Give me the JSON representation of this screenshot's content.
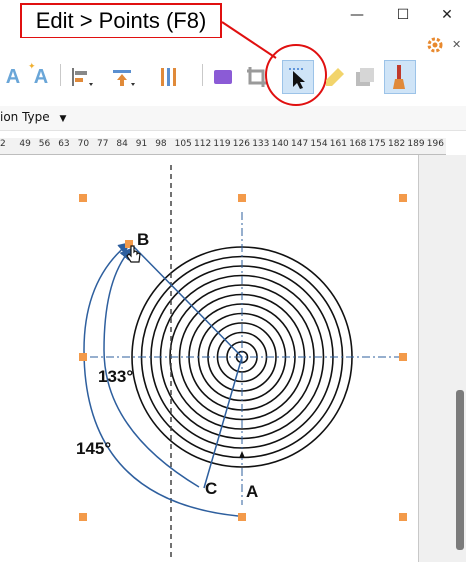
{
  "callout": {
    "text": "Edit > Points (F8)"
  },
  "window": {
    "minimize": "—",
    "maximize": "☐",
    "close": "✕"
  },
  "toolbar": {
    "tools": [
      {
        "name": "text-style-a-icon"
      },
      {
        "name": "text-effect-a-icon"
      },
      {
        "name": "align-left-icon"
      },
      {
        "name": "move-up-icon"
      },
      {
        "name": "distribute-icon"
      },
      {
        "name": "fill-color-icon"
      },
      {
        "name": "crop-icon"
      },
      {
        "name": "edit-points-icon"
      },
      {
        "name": "highlighter-icon"
      },
      {
        "name": "shadow-icon"
      },
      {
        "name": "brush-icon"
      }
    ],
    "active_tool": "edit-points-icon"
  },
  "properties": {
    "position_type": "ion Type"
  },
  "ruler": {
    "labels": [
      "2",
      "49",
      "56",
      "63",
      "70",
      "77",
      "84",
      "91",
      "98",
      "105",
      "112",
      "119",
      "126",
      "133",
      "140",
      "147",
      "154",
      "161",
      "168",
      "175",
      "182",
      "189",
      "196"
    ]
  },
  "diagram": {
    "labels": {
      "b": "B",
      "a": "A",
      "c": "C",
      "angle_small": "133°",
      "angle_large": "145°"
    },
    "accent_color": "#2e5f9e",
    "handle_color": "#f39a4a"
  }
}
